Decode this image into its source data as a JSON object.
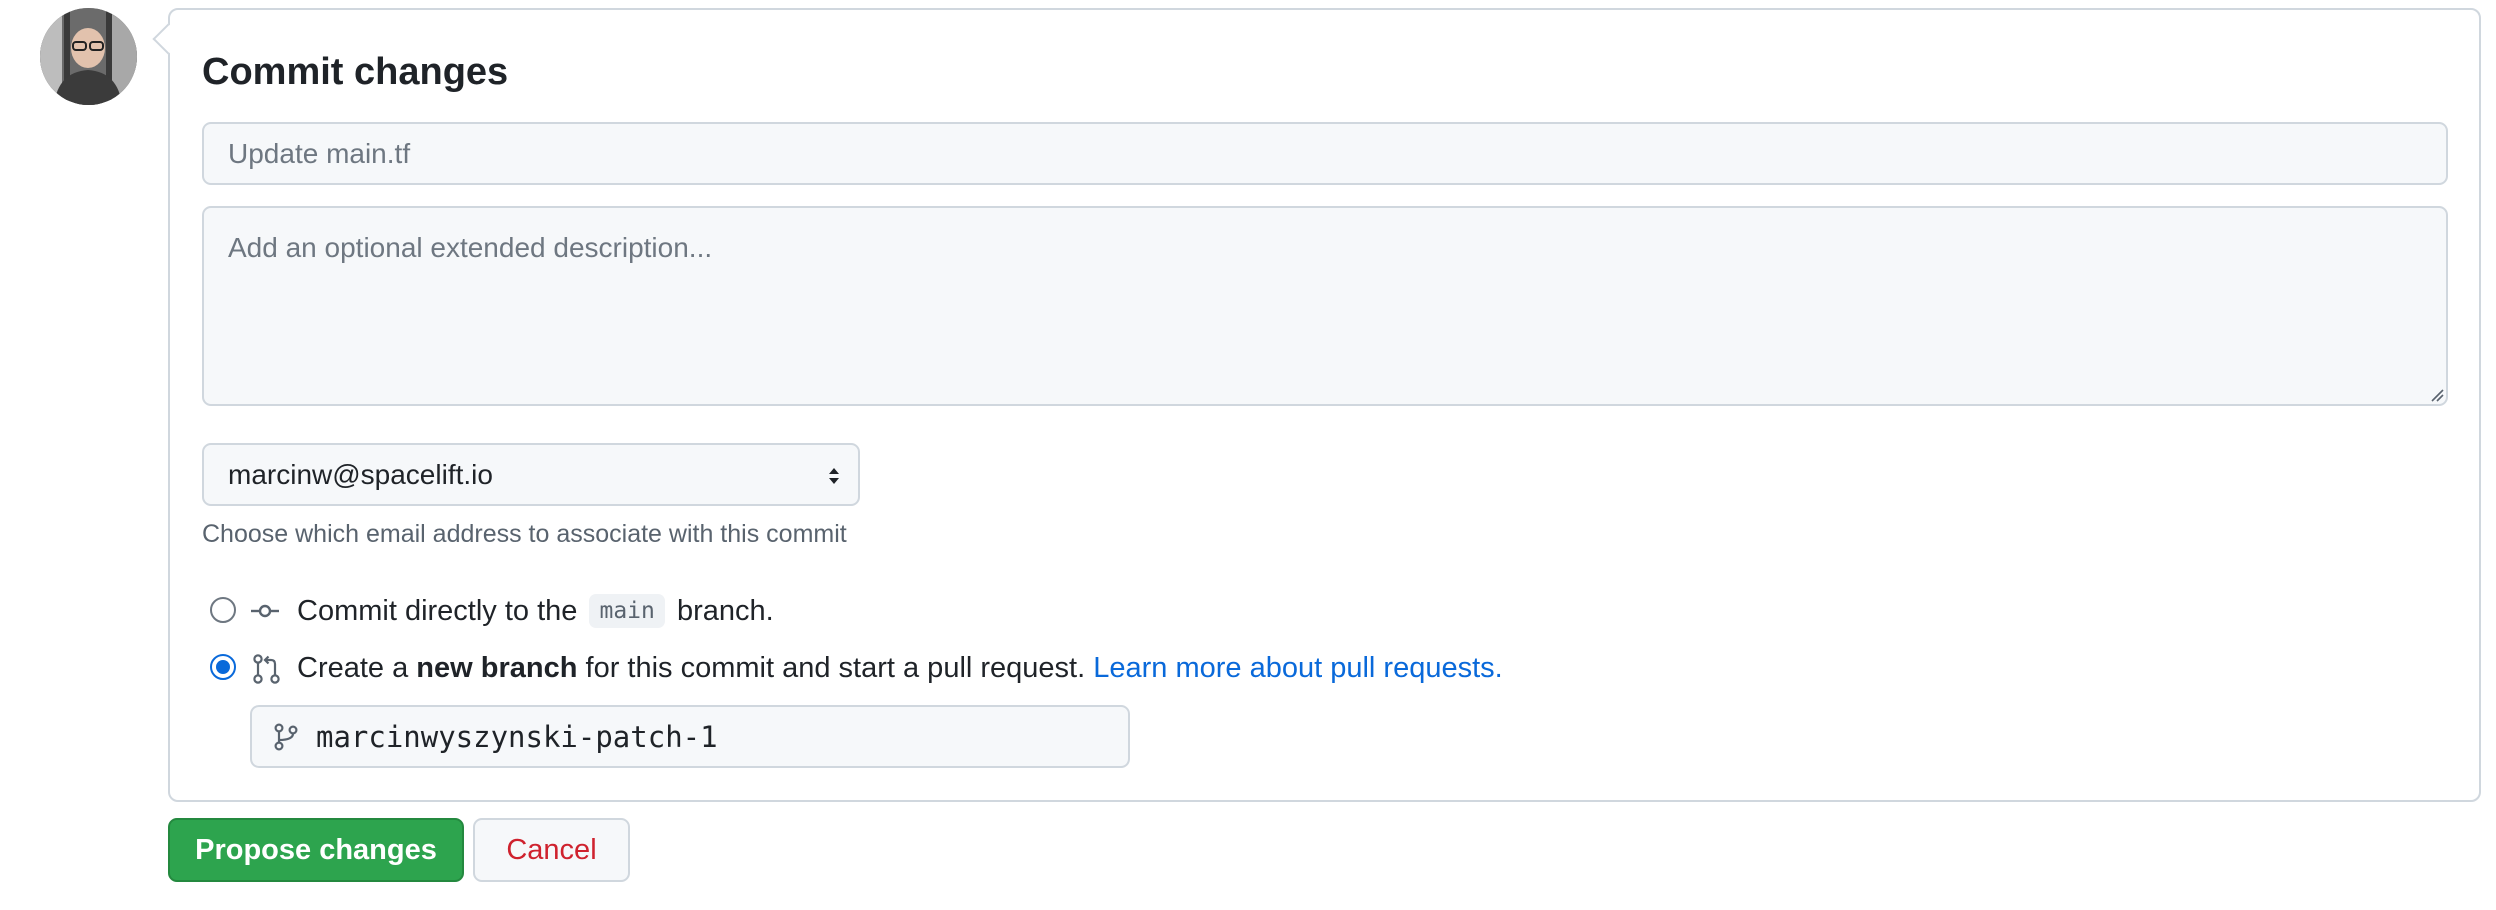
{
  "form": {
    "title": "Commit changes",
    "summary_placeholder": "Update main.tf",
    "summary_value": "",
    "description_placeholder": "Add an optional extended description...",
    "description_value": ""
  },
  "email": {
    "selected": "marcinw@spacelift.io",
    "hint": "Choose which email address to associate with this commit"
  },
  "commit_options": {
    "direct": {
      "prefix": "Commit directly to the",
      "branch_code": "main",
      "suffix": "branch.",
      "selected": false
    },
    "new_branch": {
      "prefix": "Create a",
      "bold": "new branch",
      "suffix": "for this commit and start a pull request.",
      "link": "Learn more about pull requests.",
      "selected": true
    }
  },
  "branch_name": {
    "value": "marcinwyszynski-patch-1"
  },
  "actions": {
    "propose_label": "Propose changes",
    "cancel_label": "Cancel"
  },
  "colors": {
    "propose_button": "#2da44e",
    "cancel_text": "#cf222e",
    "link": "#0969da",
    "border": "#d0d7de"
  },
  "icons": {
    "commit_option": "git-commit-icon",
    "pr_option": "git-pull-request-icon",
    "branch_field": "git-branch-icon",
    "select_caret": "select-caret-icon"
  }
}
